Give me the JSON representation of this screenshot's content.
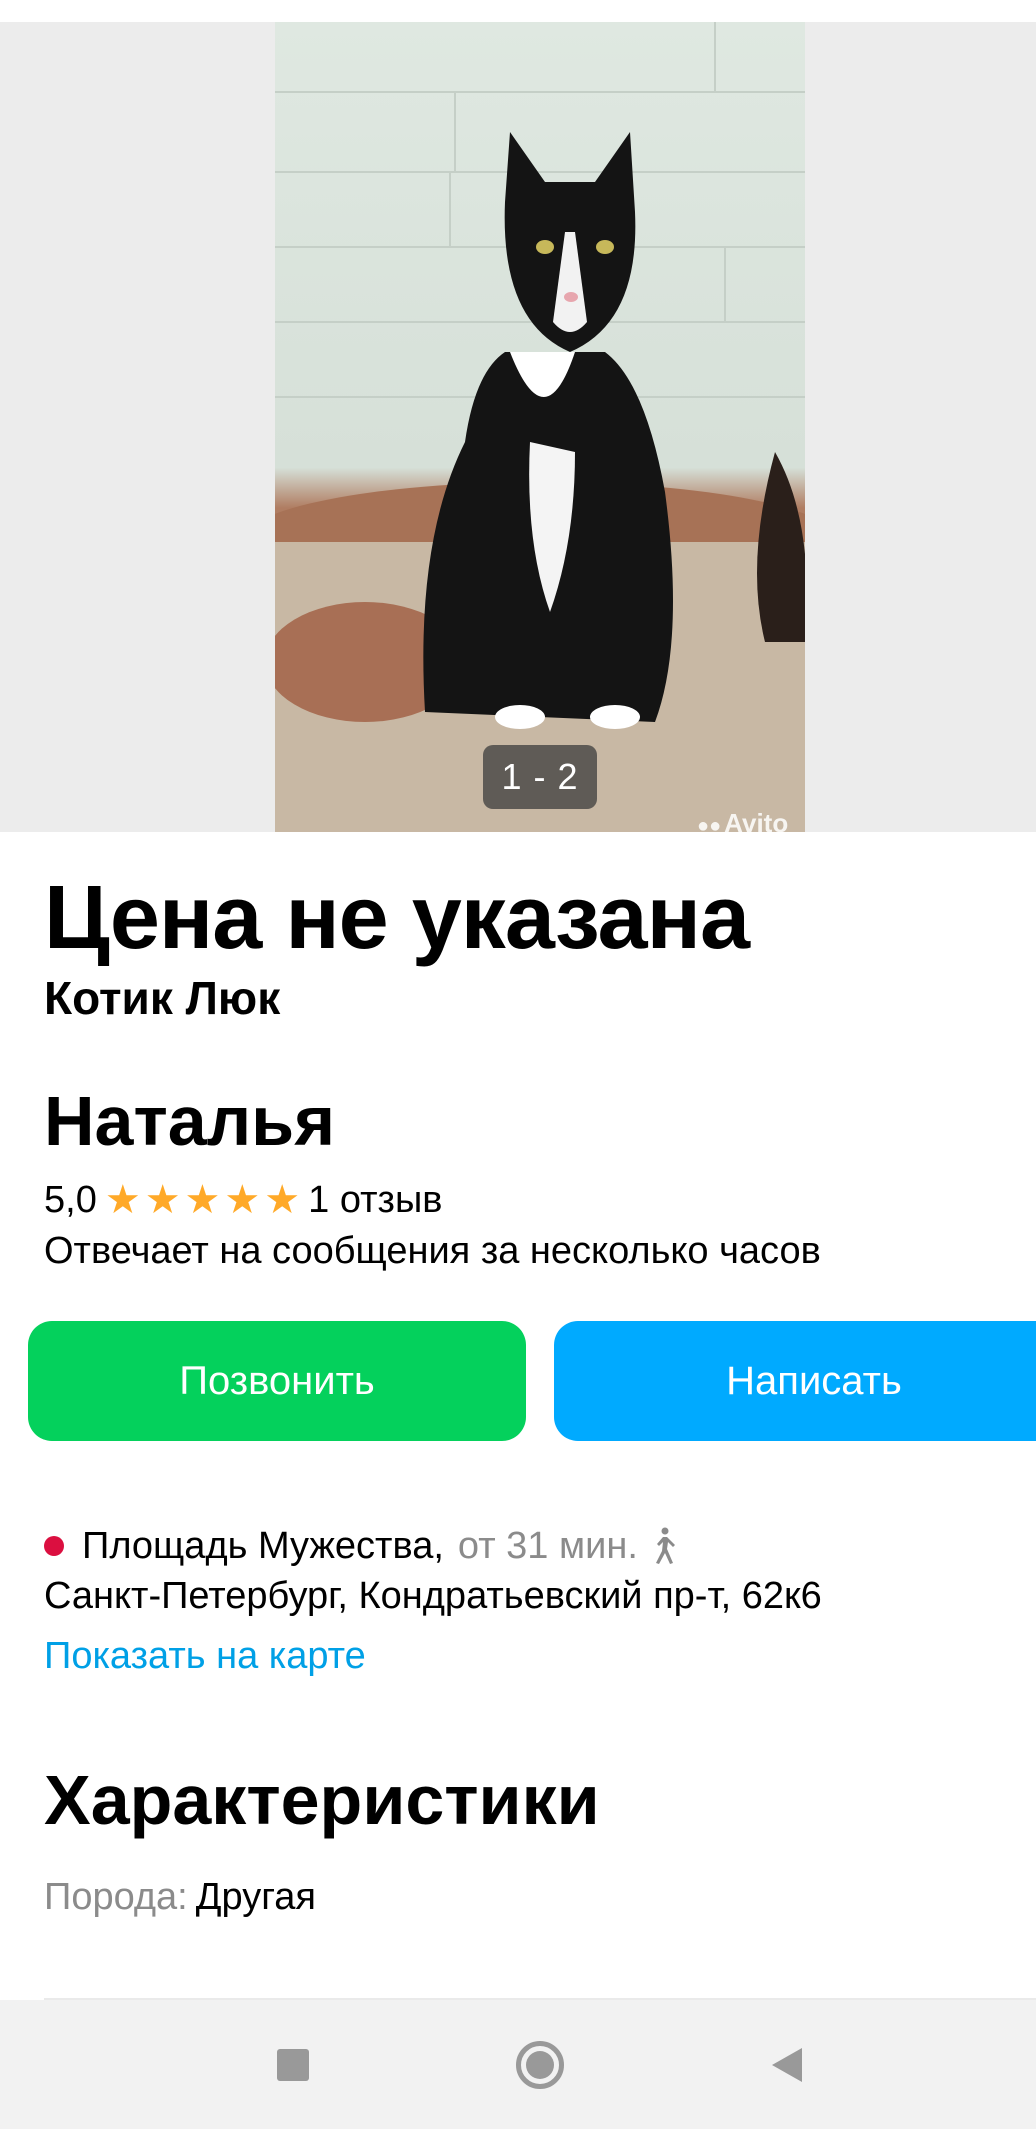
{
  "gallery": {
    "counter": "1 - 2",
    "watermark": "Avito"
  },
  "listing": {
    "price": "Цена не указана",
    "title": "Котик Люк"
  },
  "seller": {
    "name": "Наталья",
    "rating": "5,0",
    "stars": 5,
    "reviews": "1 отзыв",
    "response_time": "Отвечает на сообщения за несколько часов"
  },
  "actions": {
    "call": "Позвонить",
    "write": "Написать"
  },
  "location": {
    "metro": "Площадь Мужества,",
    "metro_time": "от 31 мин.",
    "metro_color": "#db0f40",
    "address": "Санкт-Петербург, Кондратьевский пр-т, 62к6",
    "map_link": "Показать на карте"
  },
  "specs": {
    "header": "Характеристики",
    "items": [
      {
        "label": "Порода:",
        "value": "Другая"
      }
    ]
  },
  "colors": {
    "call_button": "#04d15c",
    "write_button": "#00aaff",
    "link": "#00a0e6",
    "star": "#ffa928"
  },
  "navbar": {
    "icons": [
      "recent-apps-icon",
      "home-icon",
      "back-icon"
    ]
  }
}
